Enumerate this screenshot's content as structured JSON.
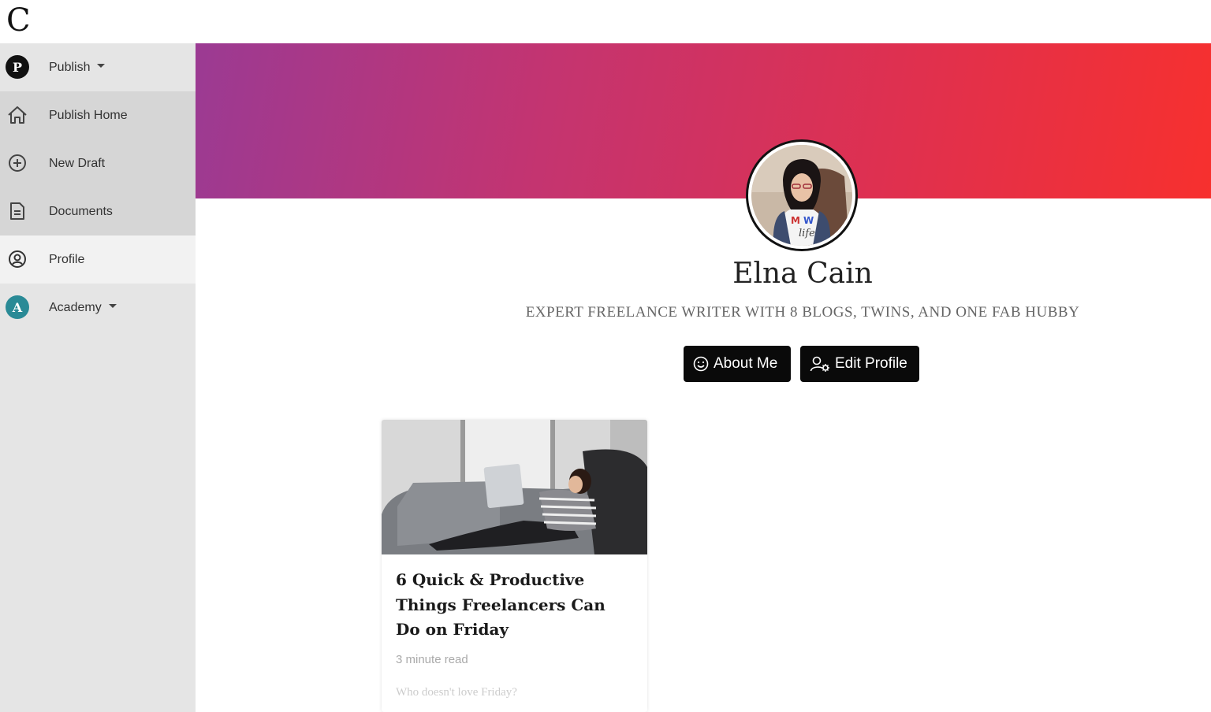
{
  "app": {
    "logo_letter": "C"
  },
  "sidebar": {
    "items": [
      {
        "label": "Publish",
        "icon": "publish-badge-icon",
        "badge_letter": "P",
        "badge_color": "#111111",
        "dropdown": true
      },
      {
        "label": "Publish Home",
        "icon": "home-icon"
      },
      {
        "label": "New Draft",
        "icon": "plus-circle-icon"
      },
      {
        "label": "Documents",
        "icon": "document-icon"
      },
      {
        "label": "Profile",
        "icon": "user-circle-icon",
        "active": true
      },
      {
        "label": "Academy",
        "icon": "academy-badge-icon",
        "badge_letter": "A",
        "badge_color": "#2a8a96",
        "dropdown": true
      }
    ]
  },
  "banner": {
    "gradient_start": "#9b3a93",
    "gradient_end": "#f7302e"
  },
  "profile": {
    "name": "Elna Cain",
    "tagline": "EXPERT FREELANCE WRITER WITH 8 BLOGS, TWINS, AND ONE FAB HUBBY",
    "buttons": {
      "about": {
        "label": "About Me",
        "icon": "smile-icon"
      },
      "edit": {
        "label": "Edit Profile",
        "icon": "user-settings-icon"
      }
    }
  },
  "posts": [
    {
      "title": "6 Quick & Productive Things Freelancers Can Do on Friday",
      "read_time": "3 minute read",
      "excerpt": "Who doesn't love Friday?"
    }
  ]
}
